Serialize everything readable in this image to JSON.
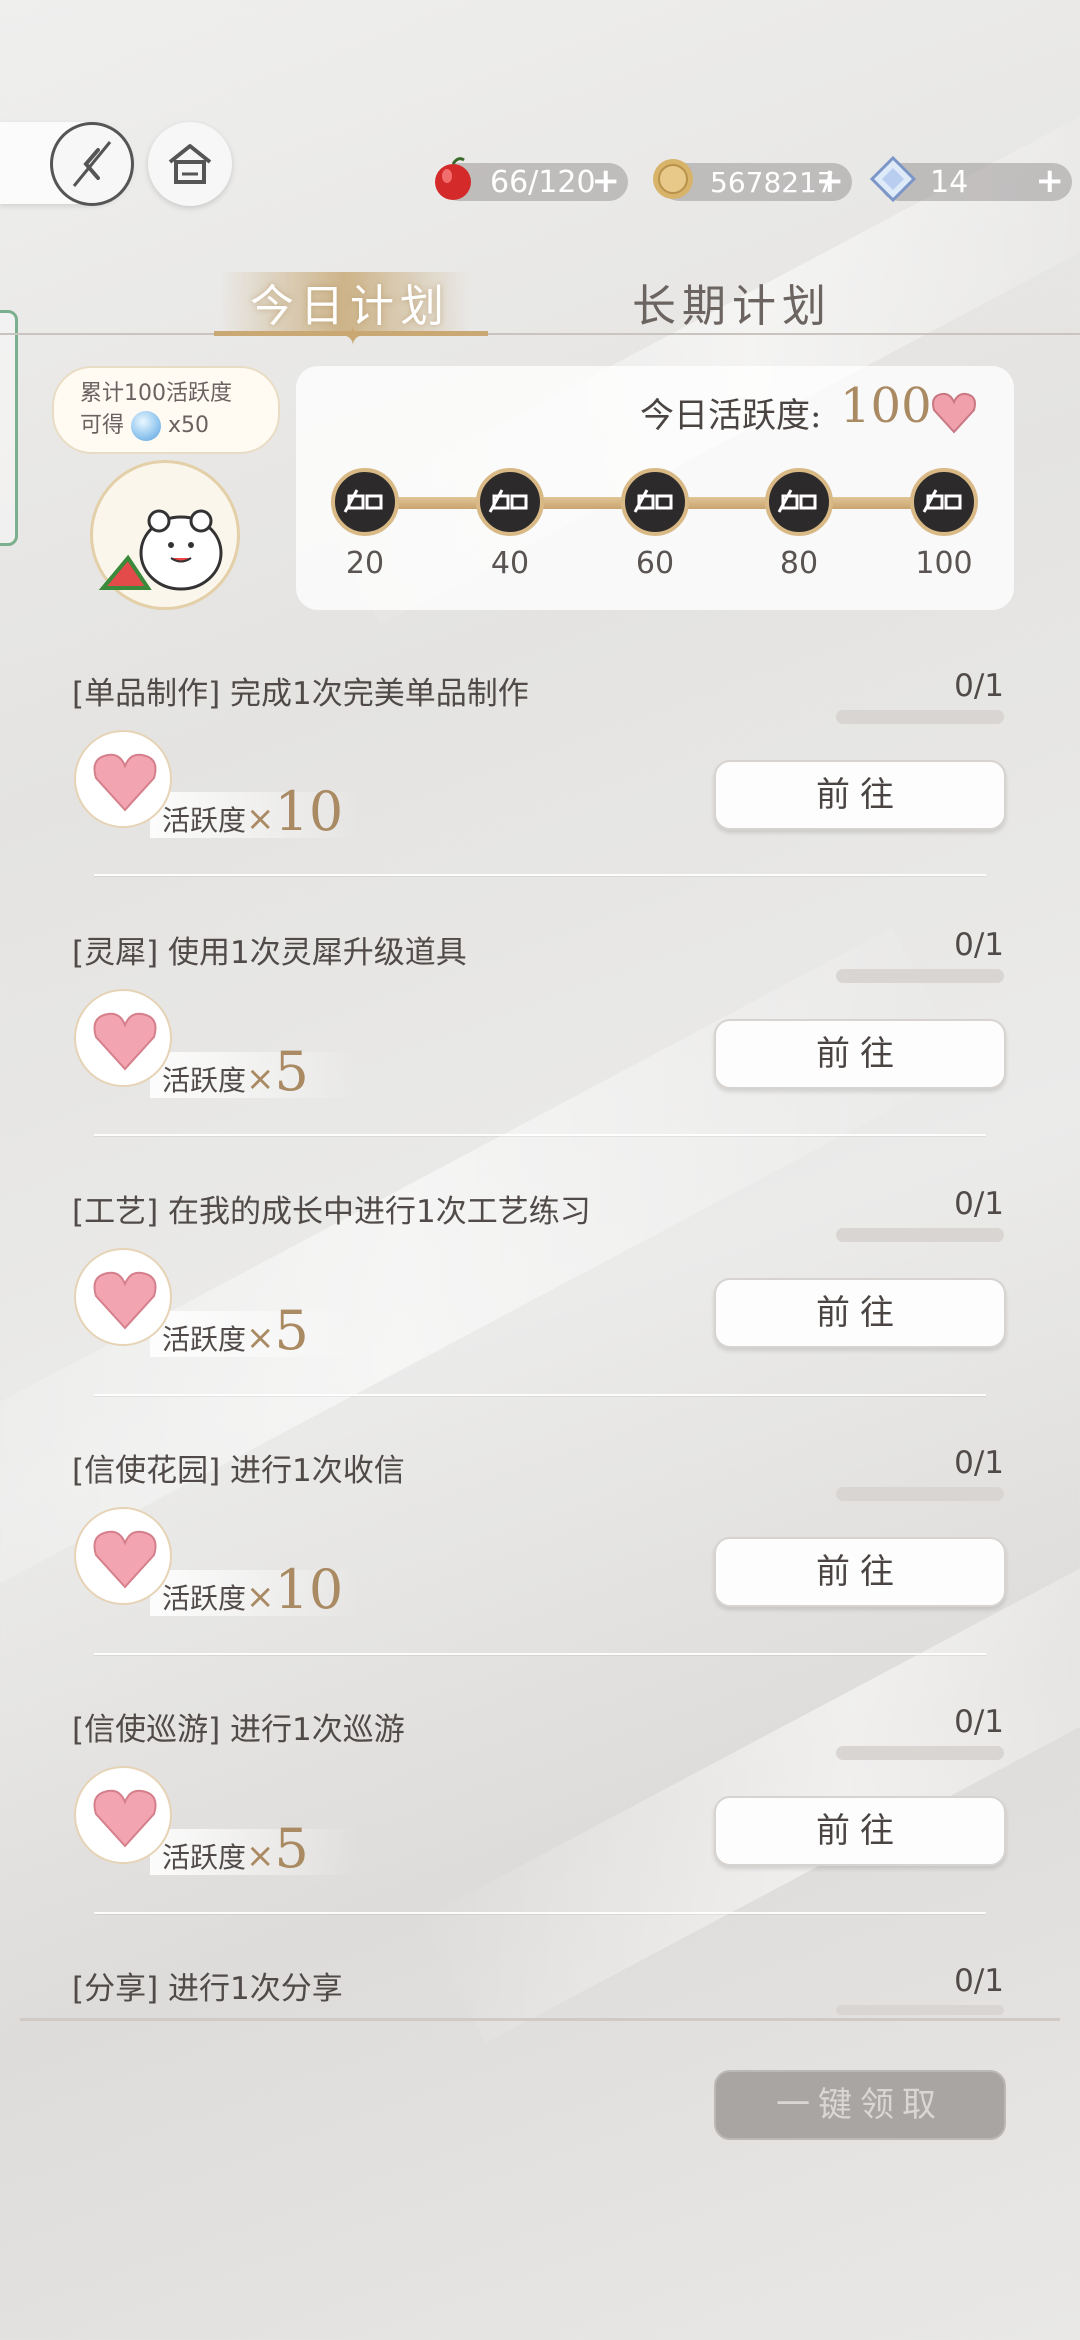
{
  "resources": [
    {
      "icon": "apple-icon",
      "value": "66/120"
    },
    {
      "icon": "coin-icon",
      "value": "5678217"
    },
    {
      "icon": "diamond-icon",
      "value": "14"
    }
  ],
  "tabs": {
    "today": "今日计划",
    "long_term": "长期计划"
  },
  "bonus": {
    "line1": "累计100活跃度",
    "line2_prefix": "可得",
    "line2_suffix": "x50"
  },
  "activity": {
    "label": "今日活跃度:",
    "value": "100",
    "milestones": [
      "20",
      "40",
      "60",
      "80",
      "100"
    ]
  },
  "tasks": [
    {
      "title": "[单品制作] 完成1次完美单品制作",
      "count": "0/1",
      "reward_label": "活跃度",
      "reward_x": "×",
      "reward_value": "10",
      "button": "前往"
    },
    {
      "title": "[灵犀] 使用1次灵犀升级道具",
      "count": "0/1",
      "reward_label": "活跃度",
      "reward_x": "×",
      "reward_value": "5",
      "button": "前往"
    },
    {
      "title": "[工艺] 在我的成长中进行1次工艺练习",
      "count": "0/1",
      "reward_label": "活跃度",
      "reward_x": "×",
      "reward_value": "5",
      "button": "前往"
    },
    {
      "title": "[信使花园] 进行1次收信",
      "count": "0/1",
      "reward_label": "活跃度",
      "reward_x": "×",
      "reward_value": "10",
      "button": "前往"
    },
    {
      "title": "[信使巡游] 进行1次巡游",
      "count": "0/1",
      "reward_label": "活跃度",
      "reward_x": "×",
      "reward_value": "5",
      "button": "前往"
    },
    {
      "title": "[分享] 进行1次分享",
      "count": "0/1"
    }
  ],
  "claim_all": "一键领取",
  "colors": {
    "accent_gold": "#c9a873",
    "reward_text": "#a98a63",
    "disabled_button": "#a9a5a3"
  }
}
